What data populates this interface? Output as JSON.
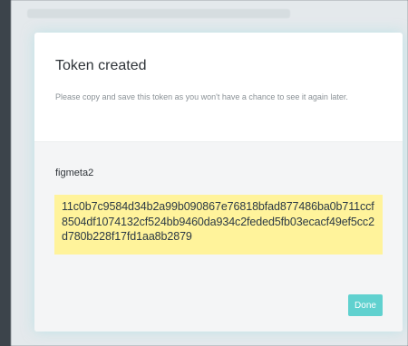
{
  "modal": {
    "title": "Token created",
    "description": "Please copy and save this token as you won't have a chance to see it again later.",
    "token_name": "figmeta2",
    "token_value": "11c0b7c9584d34b2a99b090867e76818bfad877486ba0b711ccf8504df1074132cf524bb9460da934c2feded5fb03ecacf49ef5cc2d780b228f17fd1aa8b2879",
    "done_label": "Done"
  },
  "colors": {
    "overlay": "#3c444b",
    "token_highlight": "#fff39b",
    "done_button": "#60d1cf"
  }
}
